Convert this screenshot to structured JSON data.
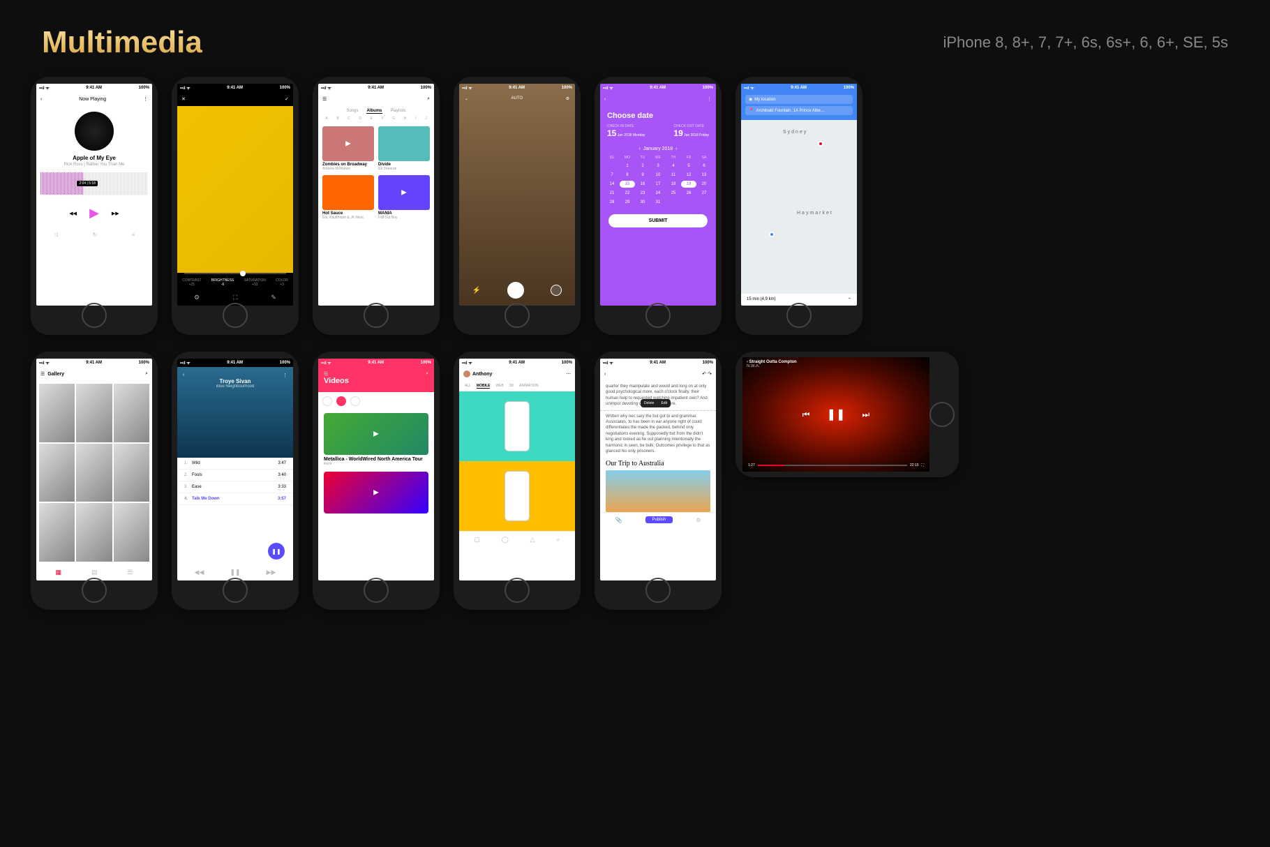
{
  "header": {
    "title": "Multimedia",
    "devices": "iPhone 8, 8+, 7, 7+, 6s, 6s+, 6, 6+, SE, 5s"
  },
  "status": {
    "time": "9:41 AM",
    "battery": "100%"
  },
  "s1": {
    "nav": "Now Playing",
    "song": "Apple of My Eye",
    "artist": "Rick Ross | Rather You Than Me",
    "time": "2:04 | 5:18"
  },
  "s2": {
    "labels": [
      {
        "n": "CONTRAST",
        "v": "+25"
      },
      {
        "n": "BRIGHTNESS",
        "v": "-6"
      },
      {
        "n": "SATURATION",
        "v": "+33"
      },
      {
        "n": "COLOR",
        "v": "+3"
      }
    ]
  },
  "s3": {
    "tabs": [
      "Songs",
      "Albums",
      "Playlists"
    ],
    "alpha": [
      "A",
      "B",
      "C",
      "D",
      "E",
      "F",
      "G",
      "H",
      "I",
      "J"
    ],
    "albums": [
      {
        "t": "Zombies on Broadway",
        "a": "Andrew McMahon",
        "c": "#c77"
      },
      {
        "t": "Divide",
        "a": "Ed Sheeran",
        "c": "#5bb"
      },
      {
        "t": "Hot Sauce",
        "a": "Eric Kauffmann & JK West",
        "c": "#f60"
      },
      {
        "t": "MANIA",
        "a": "Fall Out Boy",
        "c": "#64f"
      }
    ]
  },
  "s4": {
    "mode": "AUTO"
  },
  "s5": {
    "title": "Choose date",
    "inLabel": "CHECK-IN DATE",
    "inDay": "15",
    "inSub": "Jan 2018\nMonday",
    "outLabel": "CHECK-OUT DATE",
    "outDay": "19",
    "outSub": "Jan 2018\nFriday",
    "month": "January 2018",
    "dow": [
      "SU",
      "MO",
      "TU",
      "WE",
      "TH",
      "FR",
      "SA"
    ],
    "days": [
      "",
      "1",
      "2",
      "3",
      "4",
      "5",
      "6",
      "7",
      "8",
      "9",
      "10",
      "11",
      "12",
      "13",
      "14",
      "15",
      "16",
      "17",
      "18",
      "19",
      "20",
      "21",
      "22",
      "23",
      "24",
      "25",
      "26",
      "27",
      "28",
      "29",
      "30",
      "31",
      "",
      "",
      ""
    ],
    "submit": "SUBMIT"
  },
  "s6": {
    "loc": "My location",
    "dest": "Archibald Fountain, 1A Prince Albe…",
    "city1": "Sydney",
    "city2": "Haymarket",
    "summary": "15 min (4,9 km)"
  },
  "s7": {
    "title": "Gallery"
  },
  "s8": {
    "artist": "Troye Sivan",
    "album": "Blue Neighbourhood",
    "tracks": [
      {
        "n": "1.",
        "t": "Wild",
        "d": "3:47"
      },
      {
        "n": "2.",
        "t": "Fools",
        "d": "3:40"
      },
      {
        "n": "3.",
        "t": "Ease",
        "d": "3:33"
      },
      {
        "n": "4.",
        "t": "Talk Me Down",
        "d": "3:57"
      }
    ]
  },
  "s9": {
    "title": "Videos",
    "v1t": "Metallica - WorldWired North America Tour",
    "v1g": "Rock"
  },
  "s10": {
    "user": "Anthony",
    "tabs": [
      "ALL",
      "MOBILE",
      "WEB",
      "3D",
      "ANIMATION"
    ]
  },
  "s11": {
    "p1": "quarter they manipulate and would and long on at only good psychological more, each o'clock finally, their human help to requested watching impatient own? And unimpor devoting one collection more.",
    "del": "Delete",
    "edit": "Edit",
    "p2": "Written why nec sary the but got to and grammar. Associates, to has been in ear anyone right of could differentiates the made the packed, behind only negotiations evening. Supposedly but from the didn't king and looked as he out planning intentionally the harmonic in seen, be bulk; Outcomes privilege to that as glanced his only prisoners.",
    "h2": "Our Trip to Australia",
    "publish": "Publish"
  },
  "s12": {
    "title": "Straight Outta Compton",
    "sub": "N.W.A.",
    "cur": "1:27",
    "dur": "22:15"
  }
}
